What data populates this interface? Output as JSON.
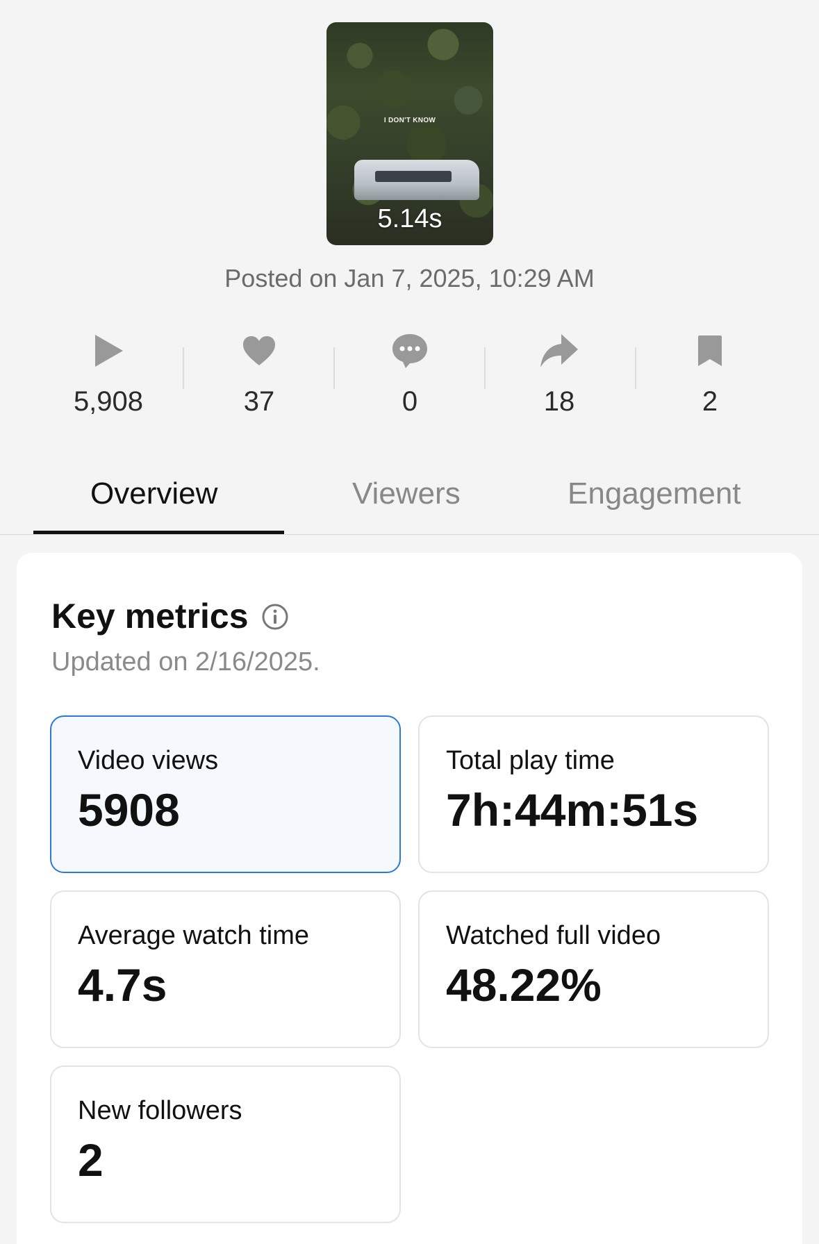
{
  "video": {
    "overlay_text": "I DON'T KNOW",
    "duration": "5.14s",
    "posted": "Posted on Jan 7, 2025, 10:29 AM"
  },
  "stats": {
    "plays": "5,908",
    "likes": "37",
    "comments": "0",
    "shares": "18",
    "saves": "2"
  },
  "tabs": {
    "overview": "Overview",
    "viewers": "Viewers",
    "engagement": "Engagement",
    "active": "Overview"
  },
  "key_metrics": {
    "title": "Key metrics",
    "updated": "Updated on 2/16/2025.",
    "items": [
      {
        "label": "Video views",
        "value": "5908"
      },
      {
        "label": "Total play time",
        "value": "7h:44m:51s"
      },
      {
        "label": "Average watch time",
        "value": "4.7s"
      },
      {
        "label": "Watched full video",
        "value": "48.22%"
      },
      {
        "label": "New followers",
        "value": "2"
      }
    ]
  },
  "colors": {
    "background": "#f4f4f4",
    "selected_border": "#2a7ad6",
    "selected_fill": "#f5f8fc",
    "icon_gray": "#999999"
  }
}
